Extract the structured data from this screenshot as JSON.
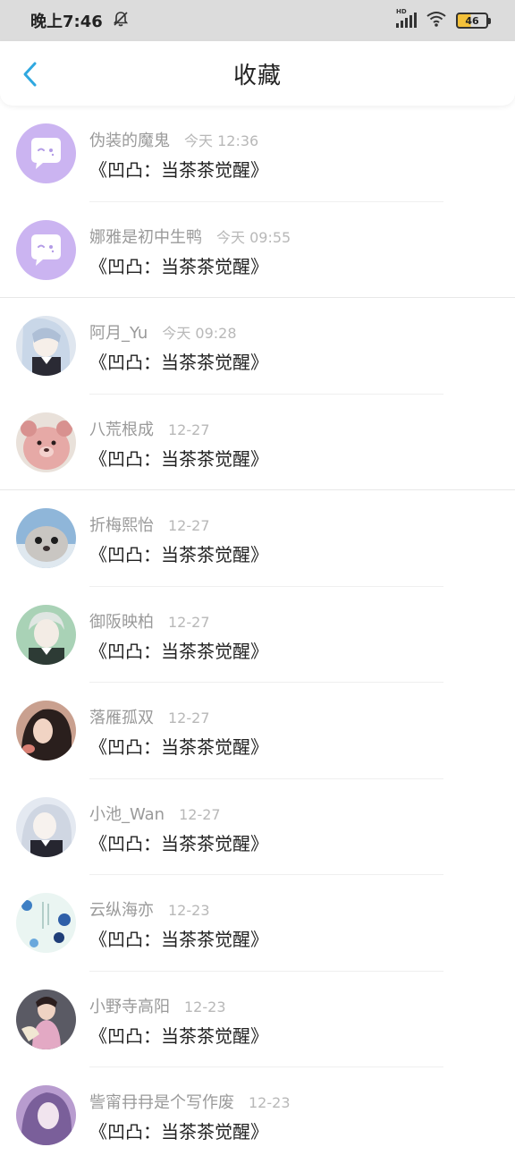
{
  "status_bar": {
    "time": "晚上7:46",
    "battery": "46",
    "network_tag": "HD"
  },
  "header": {
    "title": "收藏"
  },
  "items": [
    {
      "name": "伪装的魔鬼",
      "time": "今天 12:36",
      "content": "《凹凸：当茶茶觉醒》",
      "avatar": "chat-bubble-icon"
    },
    {
      "name": "娜雅是初中生鸭",
      "time": "今天 09:55",
      "content": "《凹凸：当茶茶觉醒》",
      "avatar": "chat-bubble-icon"
    },
    {
      "name": "阿月_Yu",
      "time": "今天 09:28",
      "content": "《凹凸：当茶茶觉醒》",
      "avatar": "anime-girl"
    },
    {
      "name": "八荒根成",
      "time": "12-27",
      "content": "《凹凸：当茶茶觉醒》",
      "avatar": "pink-bear"
    },
    {
      "name": "折梅熙怡",
      "time": "12-27",
      "content": "《凹凸：当茶茶觉醒》",
      "avatar": "seal"
    },
    {
      "name": "御阪映柏",
      "time": "12-27",
      "content": "《凹凸：当茶茶觉醒》",
      "avatar": "anime-boy"
    },
    {
      "name": "落雁孤双",
      "time": "12-27",
      "content": "《凹凸：当茶茶觉醒》",
      "avatar": "girl-photo"
    },
    {
      "name": "小池_Wan",
      "time": "12-27",
      "content": "《凹凸：当茶茶觉醒》",
      "avatar": "anime-girl-white"
    },
    {
      "name": "云纵海亦",
      "time": "12-23",
      "content": "《凹凸：当茶茶觉醒》",
      "avatar": "blue-flowers"
    },
    {
      "name": "小野寺高阳",
      "time": "12-23",
      "content": "《凹凸：当茶茶觉醒》",
      "avatar": "qipao-girl"
    },
    {
      "name": "訾甯冄冄是个写作废",
      "time": "12-23",
      "content": "《凹凸：当茶茶觉醒》",
      "avatar": "purple-anime"
    }
  ]
}
